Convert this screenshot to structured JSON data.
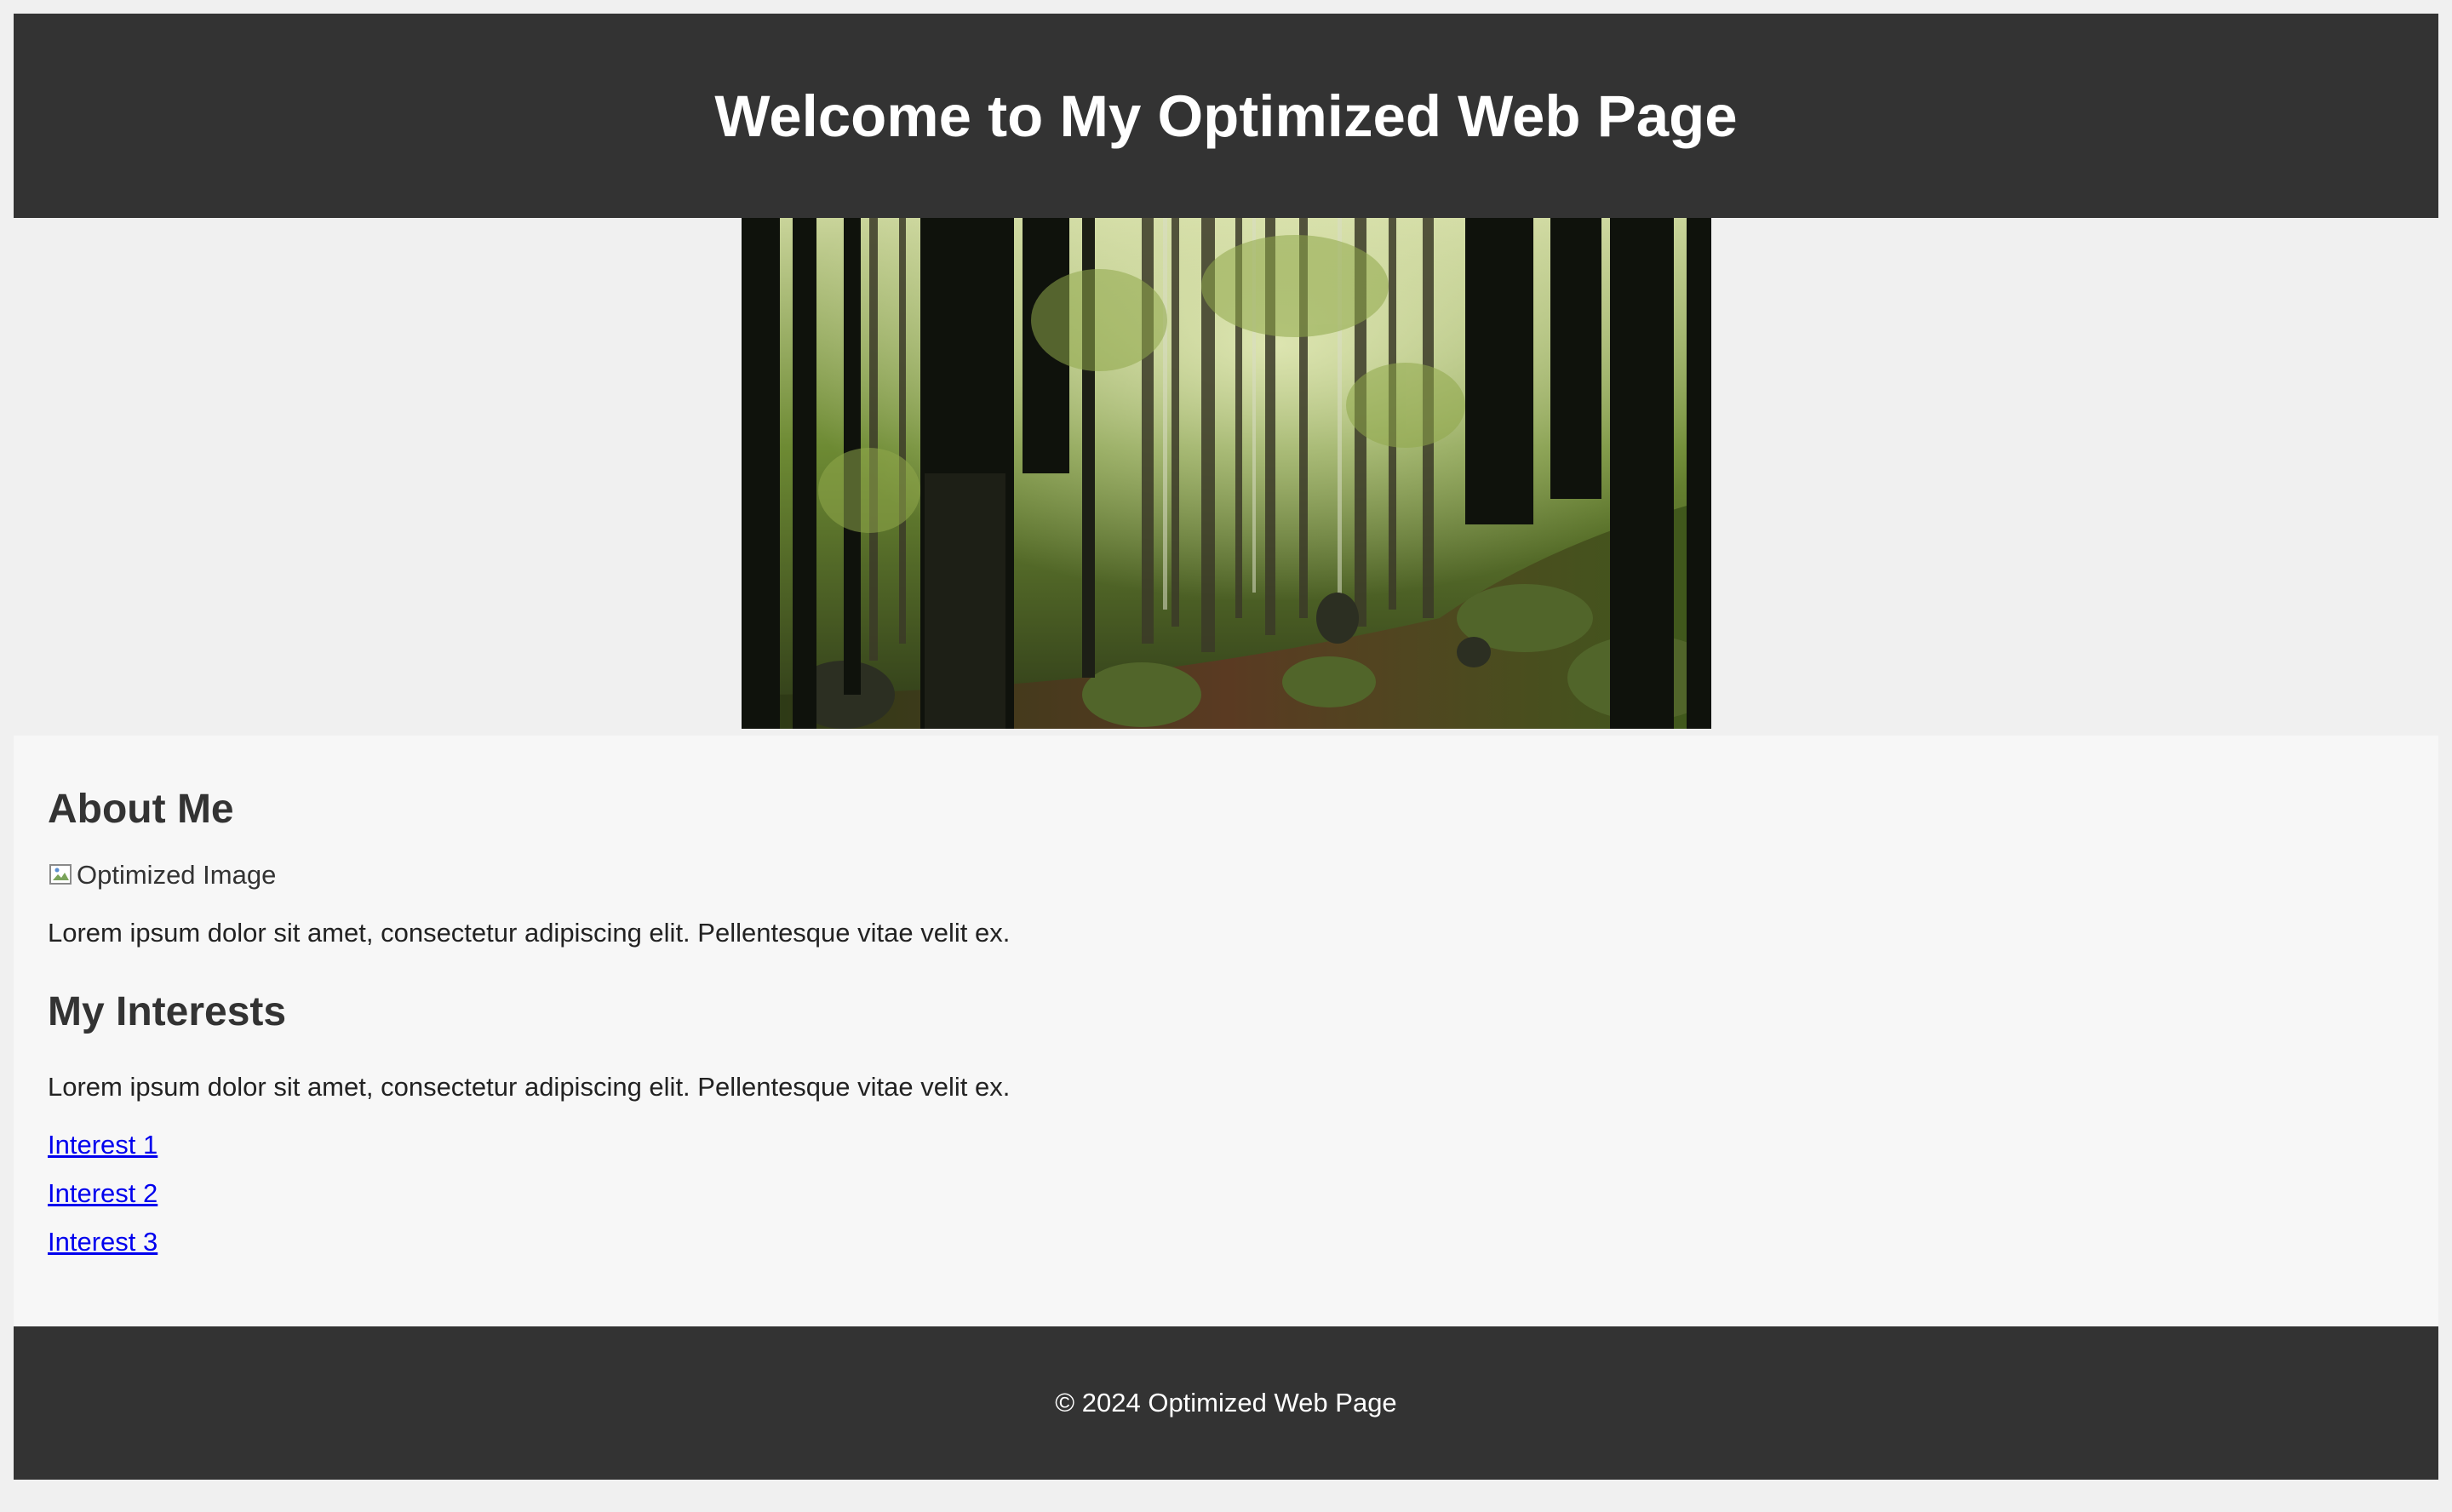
{
  "header": {
    "title": "Welcome to My Optimized Web Page"
  },
  "hero": {
    "icon": "forest-photo",
    "colors": {
      "dark_trunk": "#0f120c",
      "canopy": "#6f8a35",
      "light": "#d6dfa8",
      "moss": "#51652a",
      "soil": "#5a3a22"
    }
  },
  "main": {
    "about": {
      "heading": "About Me",
      "image_alt": "Optimized Image",
      "text": "Lorem ipsum dolor sit amet, consectetur adipiscing elit. Pellentesque vitae velit ex."
    },
    "interests": {
      "heading": "My Interests",
      "text": "Lorem ipsum dolor sit amet, consectetur adipiscing elit. Pellentesque vitae velit ex.",
      "links": [
        "Interest 1",
        "Interest 2",
        "Interest 3"
      ]
    }
  },
  "footer": {
    "text": "© 2024 Optimized Web Page"
  },
  "colors": {
    "page_bg": "#f0f0f0",
    "header_bg": "#333333",
    "main_bg": "#f7f7f7",
    "link": "#0000ee"
  }
}
